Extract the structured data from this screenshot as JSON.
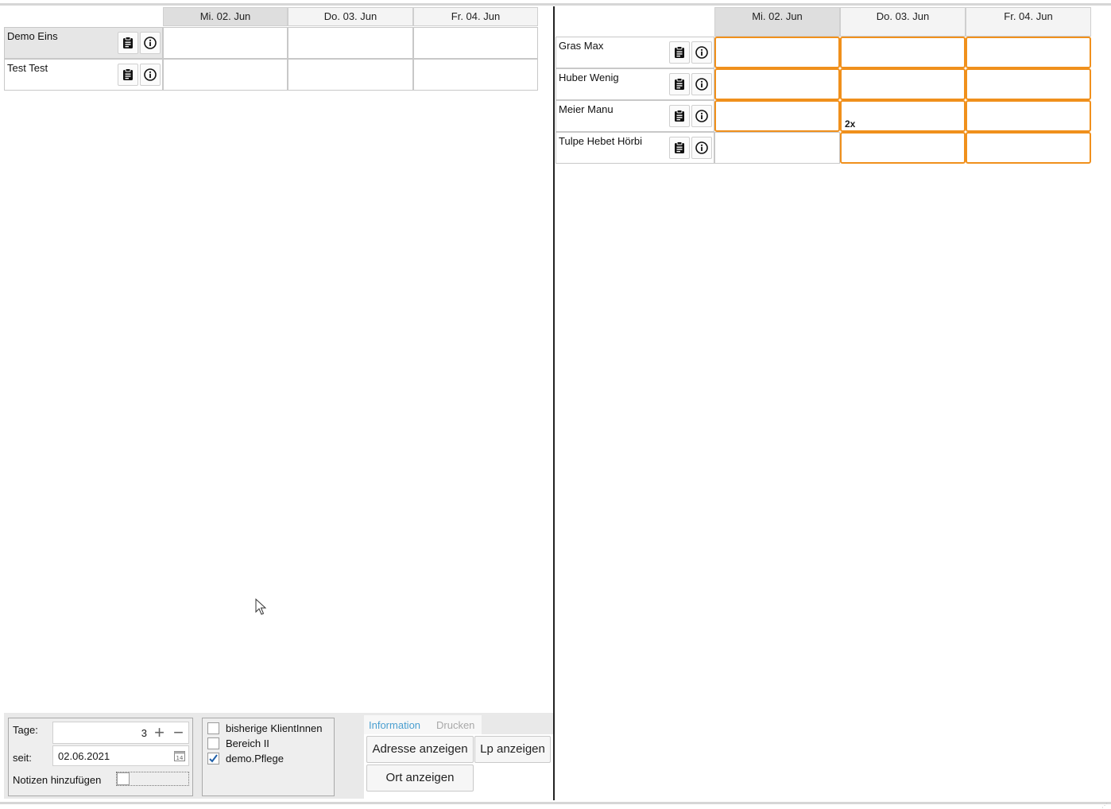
{
  "left_planner": {
    "days": [
      {
        "label": "Mi. 02. Jun",
        "selected": true
      },
      {
        "label": "Do. 03. Jun",
        "selected": false
      },
      {
        "label": "Fr. 04. Jun",
        "selected": false
      }
    ],
    "rows": [
      {
        "name": "Demo Eins",
        "selected": true
      },
      {
        "name": "Test Test",
        "selected": false
      }
    ]
  },
  "right_planner": {
    "days": [
      {
        "label": "Mi. 02. Jun",
        "selected": true
      },
      {
        "label": "Do. 03. Jun",
        "selected": false
      },
      {
        "label": "Fr. 04. Jun",
        "selected": false
      }
    ],
    "rows": [
      {
        "name": "Gras Max",
        "cells": [
          {
            "highlight": true,
            "text": ""
          },
          {
            "highlight": true,
            "text": ""
          },
          {
            "highlight": true,
            "text": ""
          }
        ]
      },
      {
        "name": "Huber Wenig",
        "cells": [
          {
            "highlight": true,
            "text": ""
          },
          {
            "highlight": true,
            "text": ""
          },
          {
            "highlight": true,
            "text": ""
          }
        ]
      },
      {
        "name": "Meier Manu",
        "cells": [
          {
            "highlight": true,
            "text": ""
          },
          {
            "highlight": true,
            "text": "2x"
          },
          {
            "highlight": true,
            "text": ""
          }
        ]
      },
      {
        "name": "Tulpe Hebet Hörbi",
        "cells": [
          {
            "highlight": false,
            "text": ""
          },
          {
            "highlight": true,
            "text": ""
          },
          {
            "highlight": true,
            "text": ""
          }
        ]
      }
    ],
    "highlight_color": "#f0901c"
  },
  "settings": {
    "days_label": "Tage:",
    "days_value": "3",
    "since_label": "seit:",
    "since_value": "02.06.2021",
    "notes_label": "Notizen hinzufügen",
    "notes_checked": false
  },
  "filters": [
    {
      "label": "bisherige KlientInnen",
      "checked": false
    },
    {
      "label": "Bereich II",
      "checked": false
    },
    {
      "label": "demo.Pflege",
      "checked": true
    }
  ],
  "info_tabs": [
    {
      "label": "Information",
      "active": true
    },
    {
      "label": "Drucken",
      "active": false
    }
  ],
  "info_buttons": {
    "address": "Adresse anzeigen",
    "lp": "Lp anzeigen",
    "location": "Ort anzeigen"
  },
  "colors": {
    "accent_tab": "#4a9fd0",
    "inactive_tab": "#a8a8a8",
    "check": "#1f5fa8"
  }
}
